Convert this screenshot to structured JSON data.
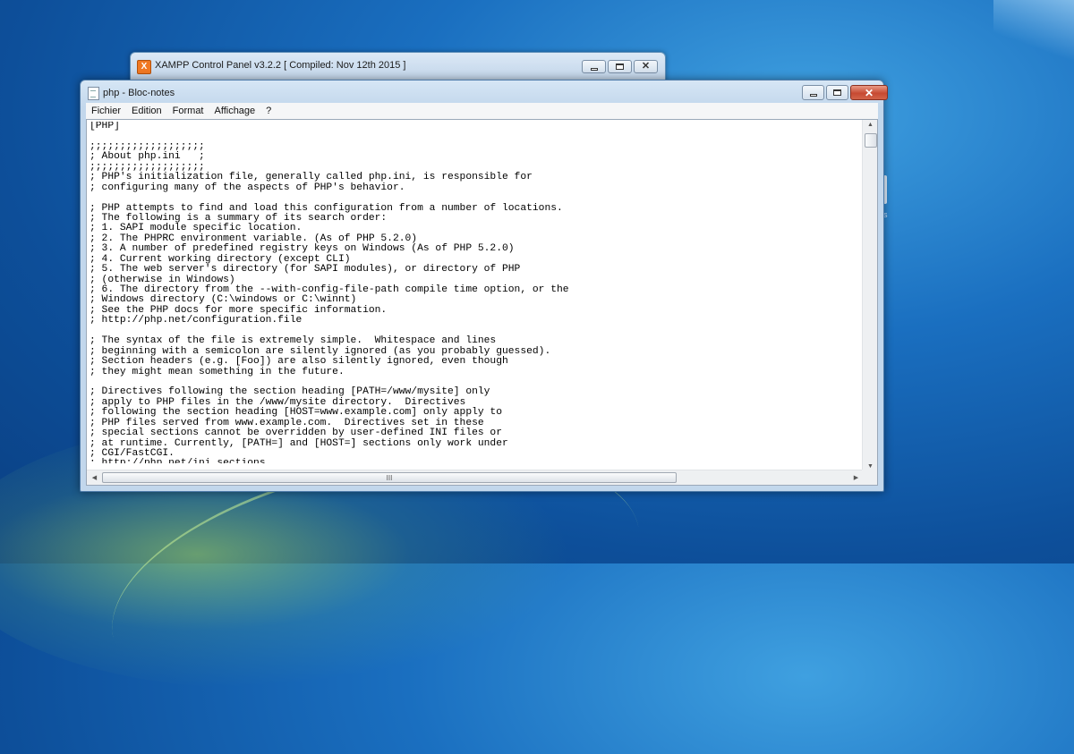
{
  "xampp_window": {
    "title": "XAMPP Control Panel v3.2.2   [ Compiled: Nov 12th 2015 ]",
    "icon_letter": "X"
  },
  "notepad_window": {
    "title": "php - Bloc-notes"
  },
  "menu": {
    "items": [
      "Fichier",
      "Edition",
      "Format",
      "Affichage",
      "?"
    ]
  },
  "editor": {
    "lines": [
      "[PHP]",
      "",
      ";;;;;;;;;;;;;;;;;;;",
      "; About php.ini   ;",
      ";;;;;;;;;;;;;;;;;;;",
      "; PHP's initialization file, generally called php.ini, is responsible for",
      "; configuring many of the aspects of PHP's behavior.",
      "",
      "; PHP attempts to find and load this configuration from a number of locations.",
      "; The following is a summary of its search order:",
      "; 1. SAPI module specific location.",
      "; 2. The PHPRC environment variable. (As of PHP 5.2.0)",
      "; 3. A number of predefined registry keys on Windows (As of PHP 5.2.0)",
      "; 4. Current working directory (except CLI)",
      "; 5. The web server's directory (for SAPI modules), or directory of PHP",
      "; (otherwise in Windows)",
      "; 6. The directory from the --with-config-file-path compile time option, or the",
      "; Windows directory (C:\\windows or C:\\winnt)",
      "; See the PHP docs for more specific information.",
      "; http://php.net/configuration.file",
      "",
      "; The syntax of the file is extremely simple.  Whitespace and lines",
      "; beginning with a semicolon are silently ignored (as you probably guessed).",
      "; Section headers (e.g. [Foo]) are also silently ignored, even though",
      "; they might mean something in the future.",
      "",
      "; Directives following the section heading [PATH=/www/mysite] only",
      "; apply to PHP files in the /www/mysite directory.  Directives",
      "; following the section heading [HOST=www.example.com] only apply to",
      "; PHP files served from www.example.com.  Directives set in these",
      "; special sections cannot be overridden by user-defined INI files or",
      "; at runtime. Currently, [PATH=] and [HOST=] sections only work under",
      "; CGI/FastCGI.",
      "; http://php.net/ini.sections"
    ]
  },
  "scrollbar": {
    "hthumb_label": "III"
  }
}
